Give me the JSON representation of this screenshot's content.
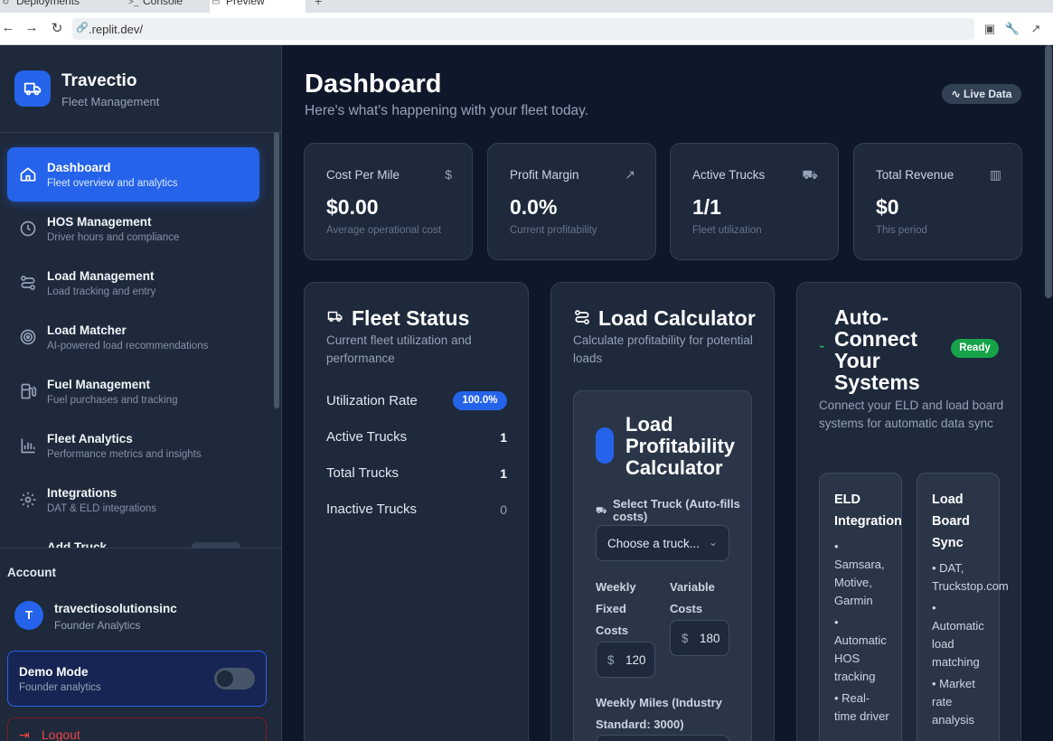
{
  "browser": {
    "tabs": [
      {
        "label": "Deployments",
        "icon": "deployments-icon"
      },
      {
        "label": "Console",
        "icon": "console-icon"
      },
      {
        "label": "Preview",
        "icon": "preview-icon"
      }
    ],
    "new_tab": "+",
    "url": ".replit.dev/"
  },
  "brand": {
    "name": "Travectio",
    "subtitle": "Fleet Management"
  },
  "nav": [
    {
      "label": "Dashboard",
      "sub": "Fleet overview and analytics",
      "icon": "home-icon",
      "active": true
    },
    {
      "label": "HOS Management",
      "sub": "Driver hours and compliance",
      "icon": "clock-icon"
    },
    {
      "label": "Load Management",
      "sub": "Load tracking and entry",
      "icon": "route-icon"
    },
    {
      "label": "Load Matcher",
      "sub": "AI-powered load recommendations",
      "icon": "target-icon"
    },
    {
      "label": "Fuel Management",
      "sub": "Fuel purchases and tracking",
      "icon": "fuel-icon"
    },
    {
      "label": "Fleet Analytics",
      "sub": "Performance metrics and insights",
      "icon": "bar-chart-icon"
    },
    {
      "label": "Integrations",
      "sub": "DAT & ELD integrations",
      "icon": "gear-icon"
    },
    {
      "label": "Add Truck",
      "sub": "",
      "icon": "truck-icon"
    }
  ],
  "account": {
    "title": "Account",
    "avatar": "T",
    "name": "travectiosolutionsinc",
    "role": "Founder Analytics",
    "demo_title": "Demo Mode",
    "demo_sub": "Founder analytics",
    "demo_enabled": false,
    "logout": "Logout"
  },
  "header": {
    "title": "Dashboard",
    "subtitle": "Here's what's happening with your fleet today.",
    "live_badge": "Live Data"
  },
  "stats": [
    {
      "label": "Cost Per Mile",
      "value": "$0.00",
      "note": "Average operational cost",
      "icon": "dollar-icon"
    },
    {
      "label": "Profit Margin",
      "value": "0.0%",
      "note": "Current profitability",
      "icon": "trending-up-icon"
    },
    {
      "label": "Active Trucks",
      "value": "1/1",
      "note": "Fleet utilization",
      "icon": "truck-icon"
    },
    {
      "label": "Total Revenue",
      "value": "$0",
      "note": "This period",
      "icon": "bar-chart-icon"
    }
  ],
  "fleet_status": {
    "title": "Fleet Status",
    "subtitle": "Current fleet utilization and performance",
    "rows": [
      {
        "label": "Utilization Rate",
        "value": "100.0%"
      },
      {
        "label": "Active Trucks",
        "value": "1"
      },
      {
        "label": "Total Trucks",
        "value": "1"
      },
      {
        "label": "Inactive Trucks",
        "value": "0"
      }
    ]
  },
  "load_calculator": {
    "title": "Load Calculator",
    "subtitle": "Calculate profitability for potential loads",
    "inner_title": "Load Profitability Calculator",
    "select_label": "Select Truck (Auto-fills costs)",
    "select_placeholder": "Choose a truck...",
    "fixed_label": "Weekly Fixed Costs",
    "fixed_value": "120",
    "variable_label": "Variable Costs",
    "variable_value": "180",
    "currency": "$",
    "miles_label": "Weekly Miles (Industry Standard: 3000)"
  },
  "auto_connect": {
    "title": "Auto-Connect Your Systems",
    "badge": "Ready",
    "subtitle": "Connect your ELD and load board systems for automatic data sync",
    "eld": {
      "title": "ELD Integration",
      "items": [
        "Samsara, Motive, Garmin",
        "Automatic HOS tracking",
        "Real-time driver"
      ]
    },
    "loadboard": {
      "title": "Load Board Sync",
      "items": [
        "DAT, Truckstop.com",
        "Automatic load matching",
        "Market rate analysis"
      ]
    }
  }
}
